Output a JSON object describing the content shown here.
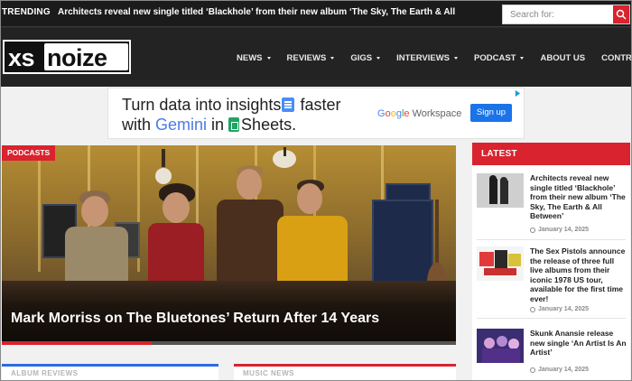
{
  "topbar": {
    "trending_label": "TRENDING",
    "trending_text": "Architects reveal new single titled ‘Blackhole’ from their new album ‘The Sky, The Earth & All",
    "search_placeholder": "Search for:"
  },
  "logo": {
    "part1": "xs",
    "part2": "noize"
  },
  "nav": {
    "items": [
      {
        "label": "NEWS",
        "has_dropdown": true
      },
      {
        "label": "REVIEWS",
        "has_dropdown": true
      },
      {
        "label": "GIGS",
        "has_dropdown": true
      },
      {
        "label": "INTERVIEWS",
        "has_dropdown": true
      },
      {
        "label": "PODCAST",
        "has_dropdown": true
      },
      {
        "label": "ABOUT US",
        "has_dropdown": false
      },
      {
        "label": "CONTRIBUTE",
        "has_dropdown": false
      }
    ]
  },
  "ad": {
    "line1_pre": "Turn data into insights",
    "line1_post": " faster",
    "line2_pre": "with ",
    "line2_gemini": "Gemini",
    "line2_mid": " in ",
    "line2_sheets": "Sheets.",
    "brand": "Google Workspace",
    "cta": "Sign up"
  },
  "feature": {
    "tag": "PODCASTS",
    "title": "Mark Morriss on The Bluetones’ Return After 14 Years",
    "slide_progress": 0.33
  },
  "latest": {
    "header": "LATEST",
    "items": [
      {
        "title": "Architects reveal new single titled ‘Blackhole’ from their new album ‘The Sky, The Earth & All Between’",
        "date": "January 14, 2025"
      },
      {
        "title": "The Sex Pistols announce the release of three full live albums from their iconic 1978 US tour, available for the first time ever!",
        "date": "January 14, 2025"
      },
      {
        "title": "Skunk Anansie release new single ‘An Artist Is An Artist’",
        "date": "January 14, 2025"
      }
    ]
  },
  "cards": {
    "left_label": "ALBUM REVIEWS",
    "right_label": "MUSIC NEWS"
  },
  "colors": {
    "accent_red": "#d9232e",
    "accent_blue": "#2d6cdf",
    "nav_bg": "#232323",
    "topbar_bg": "#1b1b1b"
  }
}
